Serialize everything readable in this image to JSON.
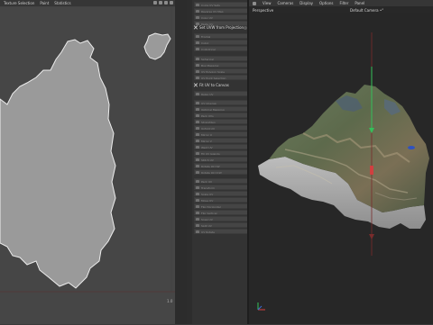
{
  "uv_editor": {
    "menu": [
      "Texture Selection",
      "Paint",
      "Statistics"
    ],
    "scale_label": "1.0"
  },
  "tools": {
    "group1": [
      "Cycle UV Sets",
      "Reverse UV Map",
      "Copy UV",
      "Paste UV",
      "Create UV Set"
    ],
    "header1": "Set UVW from Projection",
    "group2": [
      "Frontal",
      "Cubic",
      "Cylindrical",
      "Spherical",
      "Box Mapping"
    ],
    "group2b": [
      "UV Polygon Scale",
      "UV Point Selection",
      "Flip U",
      "Flip V"
    ],
    "header2": "Fit UV to Canvas",
    "group3": [
      "Relax UV",
      "UV Unwrap",
      "Optimal Mapping",
      "Pack UVs",
      "Straighten",
      "Unfold UV",
      "Mirror U",
      "Mirror V",
      "Weld UV",
      "Fill UV Islands",
      "Stitch UV",
      "Rotate 90 CW",
      "Rotate 90 CCW"
    ],
    "group4": [
      "Pack UV",
      "Transform",
      "Scale UV",
      "Move UV",
      "Flip Horizontal",
      "Flip Vertical",
      "Snap UV",
      "Split UV",
      "UV Rotate"
    ]
  },
  "viewport": {
    "menu": [
      "View",
      "Cameras",
      "Display",
      "Options",
      "Filter",
      "Panel"
    ],
    "perspective_label": "Perspective",
    "camera_label": "Default Camera •°"
  },
  "colors": {
    "axis_x": "#d04040",
    "axis_y": "#34c05a",
    "axis_z": "#3a6bd6"
  }
}
